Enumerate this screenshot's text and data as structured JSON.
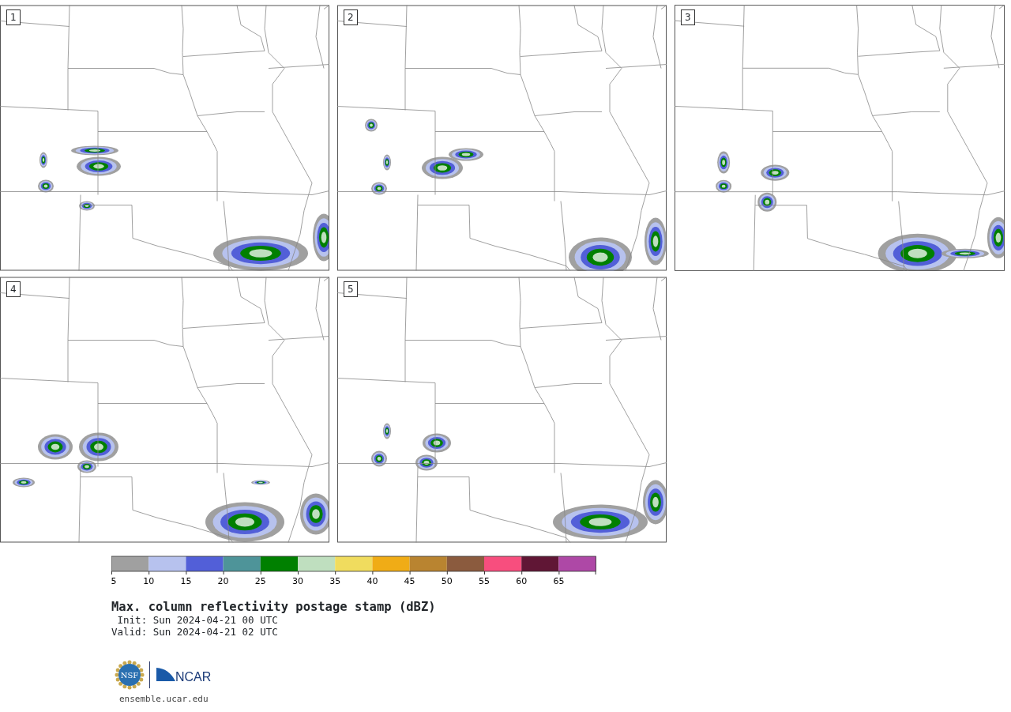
{
  "panels": [
    {
      "label": "1"
    },
    {
      "label": "2"
    },
    {
      "label": "3"
    },
    {
      "label": "4"
    },
    {
      "label": "5"
    }
  ],
  "colorbar": {
    "bins": [
      {
        "color": "#a0a0a0"
      },
      {
        "color": "#b7c2ee"
      },
      {
        "color": "#525fd8"
      },
      {
        "color": "#4e9499"
      },
      {
        "color": "#008000"
      },
      {
        "color": "#bfdfbf"
      },
      {
        "color": "#f0dc5e"
      },
      {
        "color": "#f0ac16"
      },
      {
        "color": "#b98430"
      },
      {
        "color": "#8b5b3e"
      },
      {
        "color": "#f74e7e"
      },
      {
        "color": "#601635"
      },
      {
        "color": "#ae48a6"
      }
    ],
    "tick_labels": [
      "5",
      "10",
      "15",
      "20",
      "25",
      "30",
      "35",
      "40",
      "45",
      "50",
      "55",
      "60",
      "65"
    ]
  },
  "title": "Max. column reflectivity postage stamp (dBZ)",
  "init": " Init: Sun 2024-04-21 00 UTC",
  "valid": "Valid: Sun 2024-04-21 02 UTC",
  "logos": {
    "nsf": "NSF",
    "ncar": "NCAR"
  },
  "url": "ensemble.ucar.edu"
}
